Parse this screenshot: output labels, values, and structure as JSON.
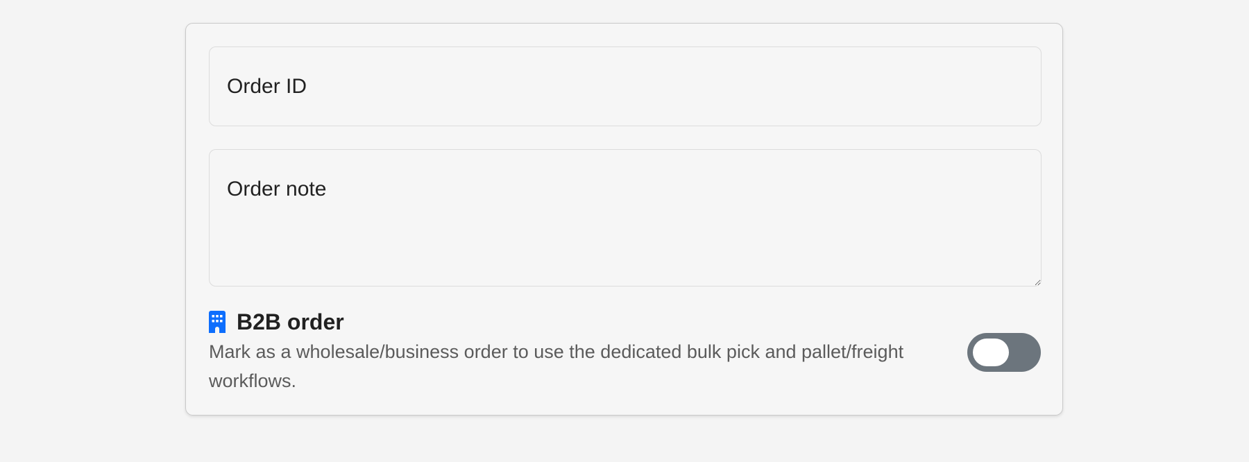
{
  "form": {
    "order_id": {
      "placeholder": "Order ID",
      "value": ""
    },
    "order_note": {
      "placeholder": "Order note",
      "value": ""
    },
    "b2b": {
      "icon": "building-icon",
      "title": "B2B order",
      "description": "Mark as a wholesale/business order to use the dedicated bulk pick and pallet/freight workflows.",
      "enabled": false,
      "icon_color": "#0d6efd",
      "toggle_off_color": "#6c757d"
    }
  }
}
